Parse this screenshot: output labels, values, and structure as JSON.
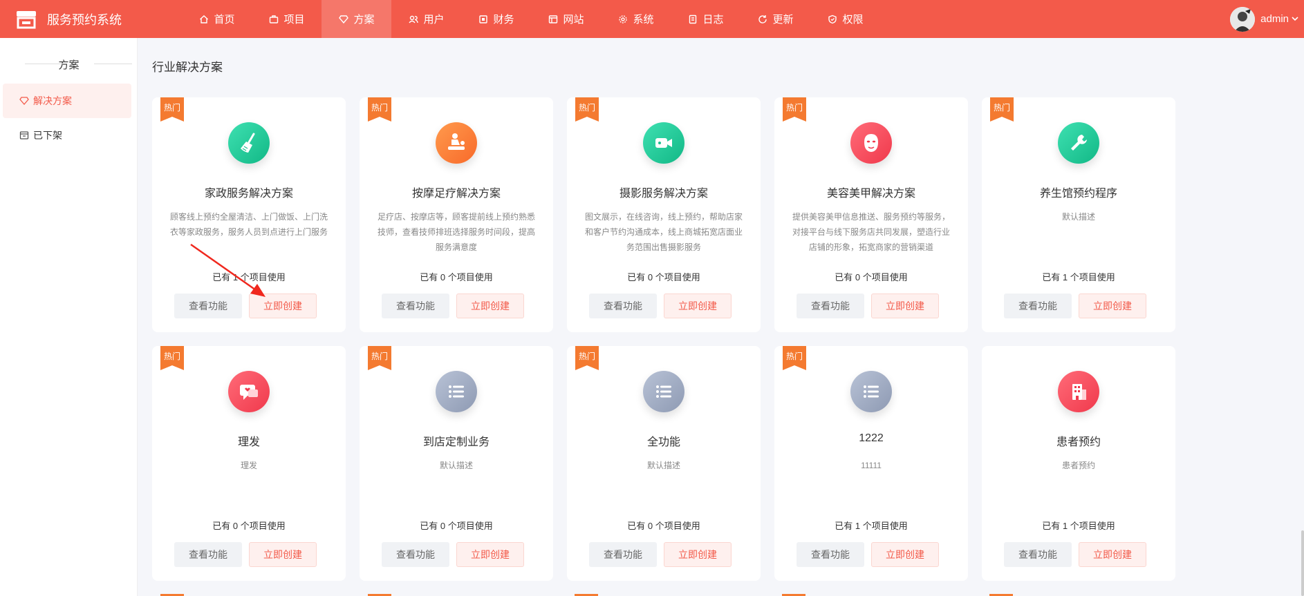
{
  "app": {
    "title": "服务预约系统"
  },
  "nav": [
    {
      "label": "首页",
      "icon": "home-icon"
    },
    {
      "label": "项目",
      "icon": "briefcase-icon"
    },
    {
      "label": "方案",
      "icon": "diamond-icon"
    },
    {
      "label": "用户",
      "icon": "users-icon"
    },
    {
      "label": "财务",
      "icon": "finance-icon"
    },
    {
      "label": "网站",
      "icon": "website-icon"
    },
    {
      "label": "系统",
      "icon": "gear-icon"
    },
    {
      "label": "日志",
      "icon": "log-icon"
    },
    {
      "label": "更新",
      "icon": "refresh-icon"
    },
    {
      "label": "权限",
      "icon": "shield-icon"
    }
  ],
  "nav_active": "方案",
  "user": {
    "name": "admin"
  },
  "sidebar": {
    "title": "方案",
    "items": [
      {
        "label": "解决方案",
        "icon": "diamond-icon"
      },
      {
        "label": "已下架",
        "icon": "archive-icon"
      }
    ]
  },
  "page": {
    "title": "行业解决方案"
  },
  "buttons": {
    "view": "查看功能",
    "create": "立即创建"
  },
  "hot_label": "热门",
  "cards": [
    {
      "title": "家政服务解决方案",
      "desc": "顾客线上预约全屋清洁、上门做饭、上门洗衣等家政服务，服务人员到点进行上门服务",
      "used": "已有 1 个项目使用",
      "hot": true,
      "icon": "broom-icon",
      "color": "green"
    },
    {
      "title": "按摩足疗解决方案",
      "desc": "足疗店、按摩店等，顾客提前线上预约熟悉技师，查看技师排班选择服务时间段，提高服务满意度",
      "used": "已有 0 个项目使用",
      "hot": true,
      "icon": "massage-icon",
      "color": "orange"
    },
    {
      "title": "摄影服务解决方案",
      "desc": "图文展示，在线咨询，线上预约，帮助店家和客户节约沟通成本，线上商城拓宽店面业务范围出售摄影服务",
      "used": "已有 0 个项目使用",
      "hot": true,
      "icon": "video-camera-icon",
      "color": "green"
    },
    {
      "title": "美容美甲解决方案",
      "desc": "提供美容美甲信息推送、服务预约等服务，对接平台与线下服务店共同发展，塑造行业店铺的形象，拓宽商家的营销渠道",
      "used": "已有 0 个项目使用",
      "hot": true,
      "icon": "face-mask-icon",
      "color": "red"
    },
    {
      "title": "养生馆预约程序",
      "desc": "默认描述",
      "used": "已有 1 个项目使用",
      "hot": true,
      "icon": "wrench-icon",
      "color": "green"
    },
    {
      "title": "理发",
      "desc": "理发",
      "used": "已有 0 个项目使用",
      "hot": true,
      "icon": "chat-bubble-icon",
      "color": "red"
    },
    {
      "title": "到店定制业务",
      "desc": "默认描述",
      "used": "已有 0 个项目使用",
      "hot": true,
      "icon": "list-icon",
      "color": "gray"
    },
    {
      "title": "全功能",
      "desc": "默认描述",
      "used": "已有 0 个项目使用",
      "hot": true,
      "icon": "list-icon",
      "color": "gray"
    },
    {
      "title": "1222",
      "desc": "11111",
      "used": "已有 1 个项目使用",
      "hot": true,
      "icon": "list-icon",
      "color": "gray"
    },
    {
      "title": "患者预约",
      "desc": "患者预约",
      "used": "已有 1 个项目使用",
      "hot": false,
      "icon": "hospital-icon",
      "color": "red"
    }
  ],
  "colors": {
    "primary": "#f35a4a",
    "hot_tag": "#f47a30",
    "annotation_arrow": "#f0281e"
  }
}
